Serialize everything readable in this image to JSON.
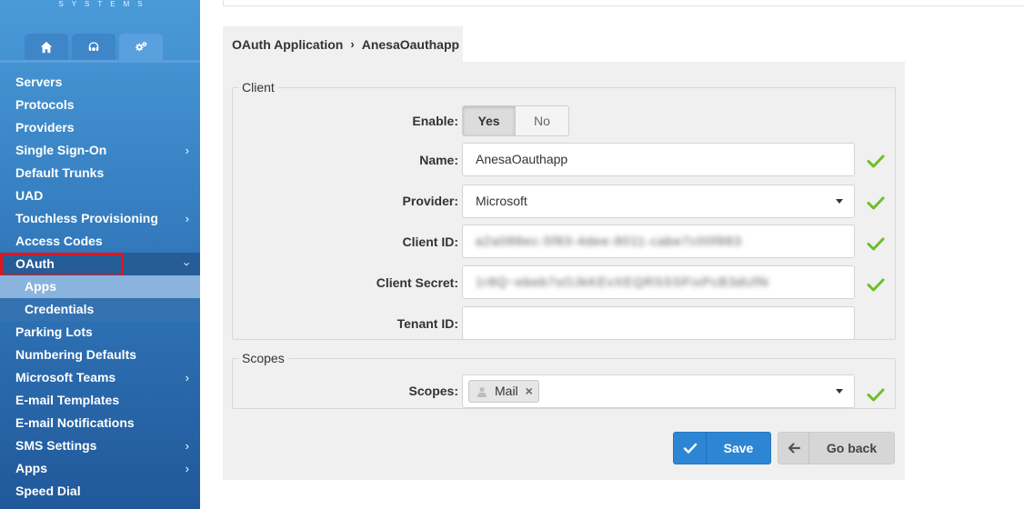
{
  "brand": {
    "text": "SYSTEMS"
  },
  "sidebar": {
    "icon_tabs": [
      {
        "icon": "home-icon"
      },
      {
        "icon": "headset-icon"
      },
      {
        "icon": "gears-icon",
        "active": true
      }
    ],
    "items": [
      {
        "label": "Servers"
      },
      {
        "label": "Protocols"
      },
      {
        "label": "Providers"
      },
      {
        "label": "Single Sign-On",
        "chevron": "›"
      },
      {
        "label": "Default Trunks"
      },
      {
        "label": "UAD"
      },
      {
        "label": "Touchless Provisioning",
        "chevron": "›"
      },
      {
        "label": "Access Codes"
      },
      {
        "label": "OAuth",
        "chevron": "›"
      },
      {
        "label": "Apps"
      },
      {
        "label": "Credentials"
      },
      {
        "label": "Parking Lots"
      },
      {
        "label": "Numbering Defaults"
      },
      {
        "label": "Microsoft Teams",
        "chevron": "›"
      },
      {
        "label": "E-mail Templates"
      },
      {
        "label": "E-mail Notifications"
      },
      {
        "label": "SMS Settings",
        "chevron": "›"
      },
      {
        "label": "Apps",
        "chevron": "›"
      },
      {
        "label": "Speed Dial"
      }
    ]
  },
  "breadcrumb": {
    "parent": "OAuth Application",
    "separator": "›",
    "current": "AnesaOauthapp"
  },
  "client": {
    "legend": "Client",
    "enable": {
      "label": "Enable:",
      "yes": "Yes",
      "no": "No",
      "selected": "Yes"
    },
    "name": {
      "label": "Name:",
      "value": "AnesaOauthapp"
    },
    "provider": {
      "label": "Provider:",
      "value": "Microsoft"
    },
    "client_id": {
      "label": "Client ID:",
      "value": "a2a088ec-5f83-4dee-8011-cabe7c00f883"
    },
    "client_secret": {
      "label": "Client Secret:",
      "value": "1r8Q~ebeb7sOJkKEvXEQRSSSFixPcB3dUfN"
    },
    "tenant_id": {
      "label": "Tenant ID:",
      "value": ""
    }
  },
  "scopes": {
    "legend": "Scopes",
    "label": "Scopes:",
    "tags": [
      "Mail"
    ],
    "remove_glyph": "×"
  },
  "actions": {
    "save": "Save",
    "back": "Go back"
  },
  "colors": {
    "valid_check": "#6bbf2a",
    "primary": "#2d86d4",
    "highlight": "#e0161e"
  }
}
